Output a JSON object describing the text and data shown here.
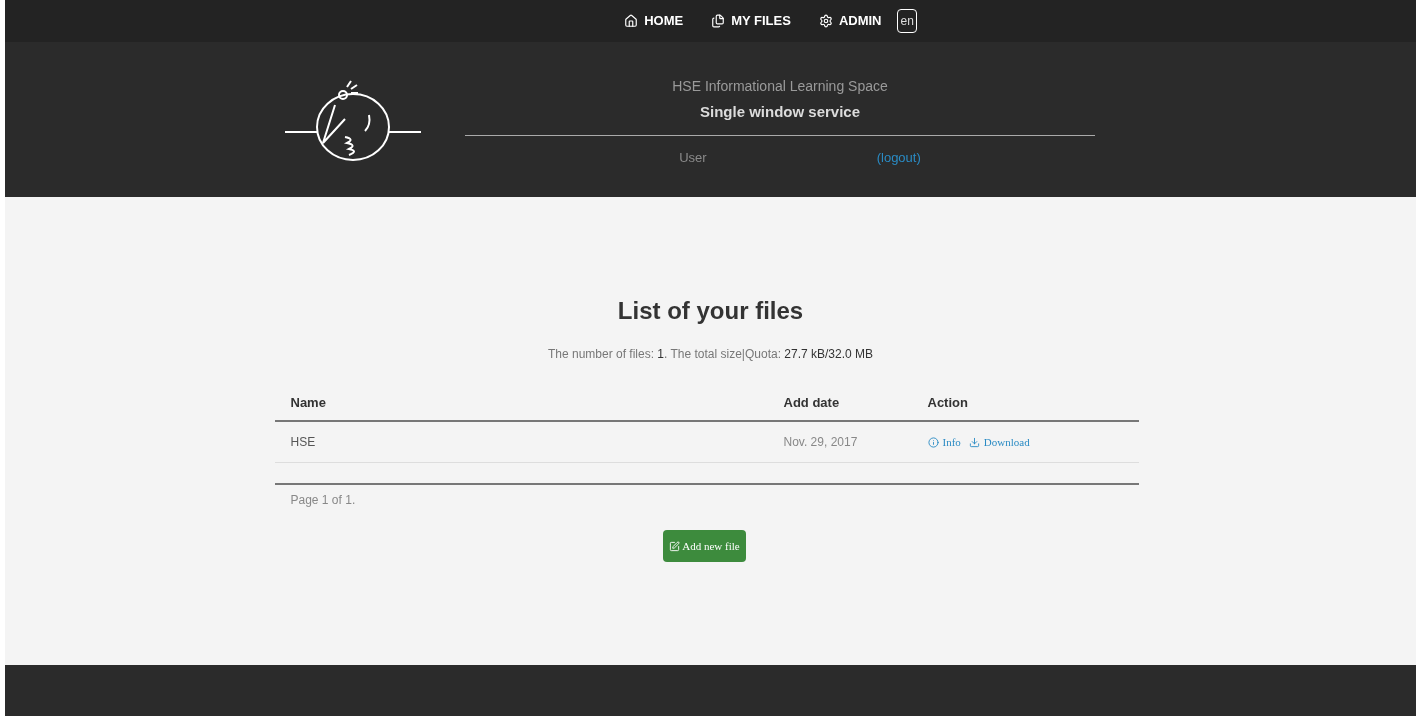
{
  "nav": {
    "items": [
      {
        "label": "HOME",
        "kind": "home"
      },
      {
        "label": "MY FILES",
        "kind": "files"
      },
      {
        "label": "ADMIN",
        "kind": "cogs"
      }
    ],
    "language": "en"
  },
  "header": {
    "title": "HSE Informational Learning Space",
    "subtitle": "Single window service",
    "user_label": "User",
    "logout": "(logout)"
  },
  "main": {
    "heading": "List of your files",
    "stats": "The number of files: **1**. The total size|Quota: **27.7 kB/32.0 MB**",
    "table": {
      "columns": [
        "Name",
        "Add date",
        "Action"
      ],
      "rows": [
        {
          "name": "HSE",
          "date": "Nov. 29, 2017",
          "actions": [
            {
              "label": "Info",
              "kind": "info"
            },
            {
              "label": "Download",
              "kind": "download"
            }
          ]
        }
      ]
    },
    "pagination": "Page 1 of 1.",
    "add_button": "Add new file"
  }
}
